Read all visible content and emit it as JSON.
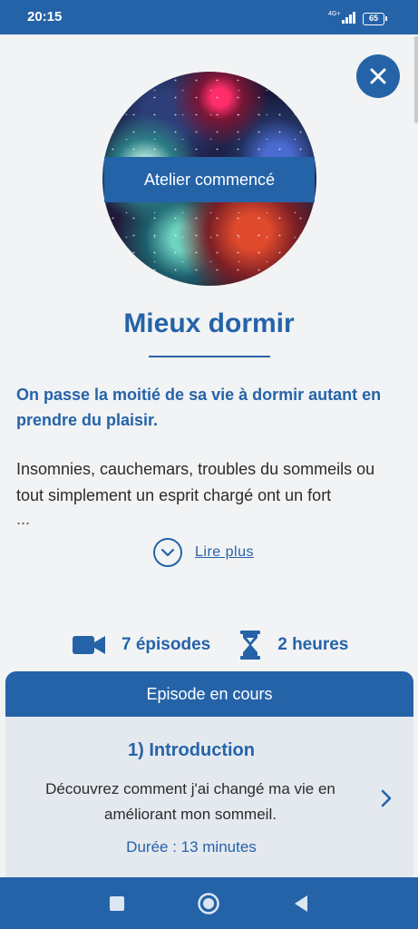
{
  "status_bar": {
    "time": "20:15",
    "network": "4G+",
    "battery": "65"
  },
  "hero": {
    "badge": "Atelier commencé"
  },
  "workshop": {
    "title": "Mieux dormir",
    "lead": "On passe la moitié de sa vie à dormir autant en prendre du plaisir.",
    "description": "Insomnies, cauchemars, troubles du sommeils ou tout simplement un esprit chargé ont un fort",
    "ellipsis": "...",
    "read_more": "Lire plus"
  },
  "stats": {
    "episodes": "7 épisodes",
    "duration": "2 heures"
  },
  "current_episode": {
    "header": "Episode en cours",
    "title": "1) Introduction",
    "description": "Découvrez comment j'ai changé ma vie en améliorant mon sommeil.",
    "duration": "Durée : 13 minutes"
  },
  "icons": {
    "close": "close-icon",
    "chevron_down": "chevron-down-icon",
    "video": "video-camera-icon",
    "hourglass": "hourglass-icon",
    "chevron_right": "chevron-right-icon",
    "nav_recent": "square-icon",
    "nav_home": "circle-icon",
    "nav_back": "triangle-back-icon"
  },
  "colors": {
    "accent": "#2563a8",
    "background": "#f2f3f4",
    "card": "#e4e9ef"
  }
}
